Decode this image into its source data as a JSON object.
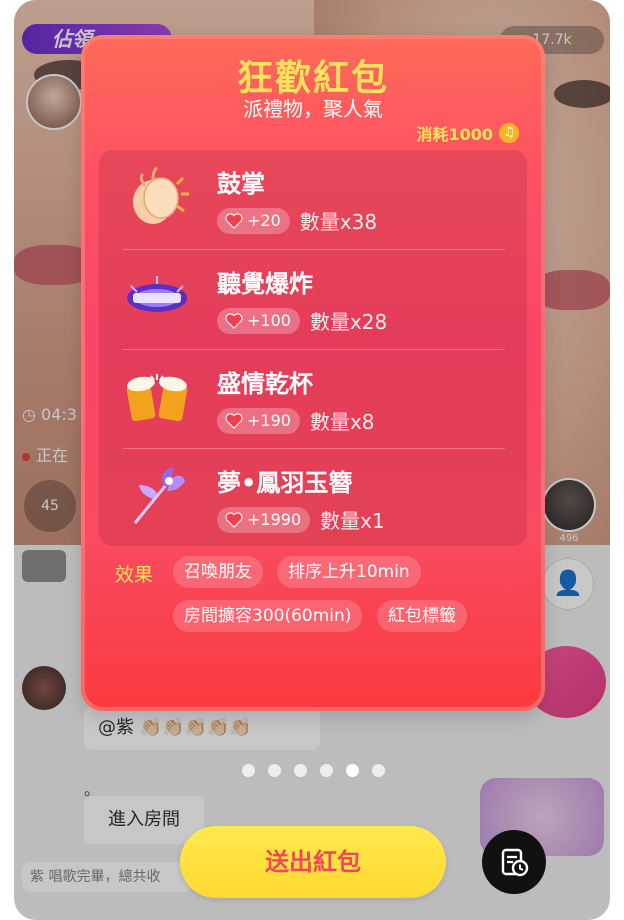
{
  "background_room": {
    "top_badge": "佔領",
    "viewer_count": "17.7k",
    "timer": "04:3",
    "status": "正在",
    "seat_left": "45",
    "seat_right_count": "496",
    "chat_bubble": "@紫",
    "chat_dot": "。",
    "enter_room": "進入房間",
    "system_message": "紫 唱歌完畢，總共收"
  },
  "popup": {
    "title": "狂歡紅包",
    "subtitle": "派禮物，聚人氣",
    "cost_label": "消耗1000",
    "cost_icon": "music-note-coin-icon",
    "gifts": [
      {
        "name": "鼓掌",
        "points": "+20",
        "quantity": "數量x38",
        "icon": "clapping-hands-icon"
      },
      {
        "name": "聽覺爆炸",
        "points": "+100",
        "quantity": "數量x28",
        "icon": "sound-explosion-icon"
      },
      {
        "name": "盛情乾杯",
        "points": "+190",
        "quantity": "數量x8",
        "icon": "beer-cheers-icon"
      },
      {
        "name": "夢•鳳羽玉簪",
        "points": "+1990",
        "quantity": "數量x1",
        "icon": "phoenix-hairpin-icon"
      }
    ],
    "effects_label": "效果",
    "effects": [
      "召喚朋友",
      "排序上升10min",
      "房間擴容300(60min)",
      "紅包標籤"
    ]
  },
  "pager": {
    "count": 6,
    "active_index": 4
  },
  "send_button": "送出紅包",
  "history_icon": "red-packet-history-icon",
  "colors": {
    "title_yellow": "#ffe25c",
    "send_text": "#f2475d",
    "popup_red": "#fa4566"
  }
}
